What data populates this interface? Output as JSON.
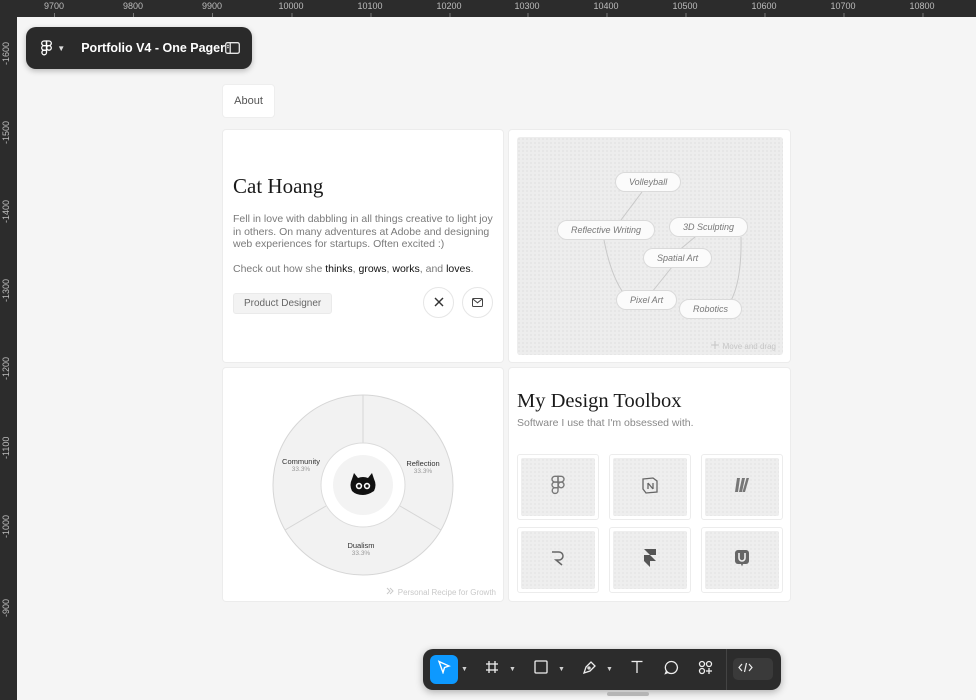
{
  "rulers": {
    "x": [
      "9700",
      "9800",
      "9900",
      "10000",
      "10100",
      "10200",
      "10300",
      "10400",
      "10500",
      "10600",
      "10700",
      "10800"
    ],
    "y": [
      "-1600",
      "-1500",
      "-1400",
      "-1300",
      "-1200",
      "-1100",
      "-1000",
      "-900"
    ]
  },
  "file": {
    "title": "Portfolio V4 - One Pager",
    "logo_icon": "figma-icon"
  },
  "about_tab": "About",
  "profile": {
    "name": "Cat Hoang",
    "bio": "Fell in love with dabbling in all things creative to light joy in others. On many adventures at Adobe and designing web experiences for startups. Often excited :)",
    "links_prefix": "Check out how she ",
    "links": [
      "thinks",
      "grows",
      "works",
      "loves"
    ],
    "sep1": ", ",
    "sep2": ", ",
    "sep3": ", and ",
    "end": ".",
    "role": "Product Designer",
    "social": [
      {
        "icon": "x-icon"
      },
      {
        "icon": "mail-icon"
      }
    ]
  },
  "interests": {
    "tags": [
      "Volleyball",
      "Reflective Writing",
      "3D Sculpting",
      "Spatial Art",
      "Pixel Art",
      "Robotics"
    ],
    "hint": "Move and drag"
  },
  "recipe": {
    "segments": [
      {
        "label": "Community",
        "value": "33.3%"
      },
      {
        "label": "Reflection",
        "value": "33.3%"
      },
      {
        "label": "Dualism",
        "value": "33.3%"
      }
    ],
    "caption": "Personal Recipe for Growth"
  },
  "toolbox": {
    "title": "My Design Toolbox",
    "subtitle": "Software I use that I'm obsessed with.",
    "tools": [
      "figma-icon",
      "notion-icon",
      "miro-icon",
      "rive-icon",
      "framer-icon",
      "uizard-icon"
    ]
  },
  "toolbar": {
    "tools": [
      "move-tool",
      "frame-tool",
      "shape-tool",
      "pen-tool",
      "text-tool",
      "comment-tool",
      "actions-tool"
    ],
    "active": "move-tool",
    "dev_mode": "dev-mode-toggle"
  },
  "colors": {
    "accent": "#0d99ff",
    "chrome": "#2c2c2c",
    "canvas": "#f5f5f5"
  }
}
